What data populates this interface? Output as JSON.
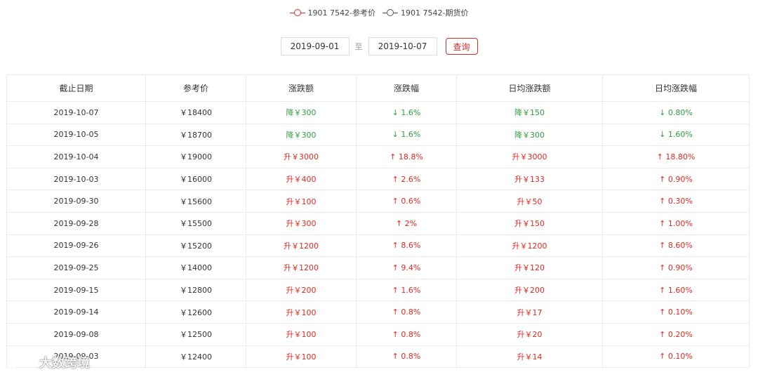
{
  "legend": {
    "items": [
      {
        "label": "1901 7542-参考价",
        "color": "#c9302c"
      },
      {
        "label": "1901 7542-期货价",
        "color": "#555555"
      }
    ]
  },
  "filter": {
    "start_date": "2019-09-01",
    "separator": "至",
    "end_date": "2019-10-07",
    "query_label": "查询"
  },
  "table": {
    "headers": [
      "截止日期",
      "参考价",
      "涨跌额",
      "涨跌幅",
      "日均涨跌额",
      "日均涨跌幅"
    ],
    "rows": [
      {
        "date": "2019-10-07",
        "price": "￥18400",
        "change": "降￥300",
        "pct": "↓ 1.6%",
        "daily_change": "降￥150",
        "daily_pct": "↓ 0.80%",
        "trend": "down"
      },
      {
        "date": "2019-10-05",
        "price": "￥18700",
        "change": "降￥300",
        "pct": "↓ 1.6%",
        "daily_change": "降￥300",
        "daily_pct": "↓ 1.60%",
        "trend": "down"
      },
      {
        "date": "2019-10-04",
        "price": "￥19000",
        "change": "升￥3000",
        "pct": "↑ 18.8%",
        "daily_change": "升￥3000",
        "daily_pct": "↑ 18.80%",
        "trend": "up"
      },
      {
        "date": "2019-10-03",
        "price": "￥16000",
        "change": "升￥400",
        "pct": "↑ 2.6%",
        "daily_change": "升￥133",
        "daily_pct": "↑ 0.90%",
        "trend": "up"
      },
      {
        "date": "2019-09-30",
        "price": "￥15600",
        "change": "升￥100",
        "pct": "↑ 0.6%",
        "daily_change": "升￥50",
        "daily_pct": "↑ 0.30%",
        "trend": "up"
      },
      {
        "date": "2019-09-28",
        "price": "￥15500",
        "change": "升￥300",
        "pct": "↑ 2%",
        "daily_change": "升￥150",
        "daily_pct": "↑ 1.00%",
        "trend": "up"
      },
      {
        "date": "2019-09-26",
        "price": "￥15200",
        "change": "升￥1200",
        "pct": "↑ 8.6%",
        "daily_change": "升￥1200",
        "daily_pct": "↑ 8.60%",
        "trend": "up"
      },
      {
        "date": "2019-09-25",
        "price": "￥14000",
        "change": "升￥1200",
        "pct": "↑ 9.4%",
        "daily_change": "升￥120",
        "daily_pct": "↑ 0.90%",
        "trend": "up"
      },
      {
        "date": "2019-09-15",
        "price": "￥12800",
        "change": "升￥200",
        "pct": "↑ 1.6%",
        "daily_change": "升￥200",
        "daily_pct": "↑ 1.60%",
        "trend": "up"
      },
      {
        "date": "2019-09-14",
        "price": "￥12600",
        "change": "升￥100",
        "pct": "↑ 0.8%",
        "daily_change": "升￥17",
        "daily_pct": "↑ 0.10%",
        "trend": "up"
      },
      {
        "date": "2019-09-08",
        "price": "￥12500",
        "change": "升￥100",
        "pct": "↑ 0.8%",
        "daily_change": "升￥20",
        "daily_pct": "↑ 0.20%",
        "trend": "up"
      },
      {
        "date": "2019-09-03",
        "price": "￥12400",
        "change": "升￥100",
        "pct": "↑ 0.8%",
        "daily_change": "升￥14",
        "daily_pct": "↑ 0.10%",
        "trend": "up"
      }
    ]
  },
  "watermark": {
    "text": "大数跨境",
    "icon": "chat-bubbles-logo-icon"
  },
  "colors": {
    "up": "#e0281e",
    "down": "#2e9e3d",
    "accent": "#c9302c"
  }
}
